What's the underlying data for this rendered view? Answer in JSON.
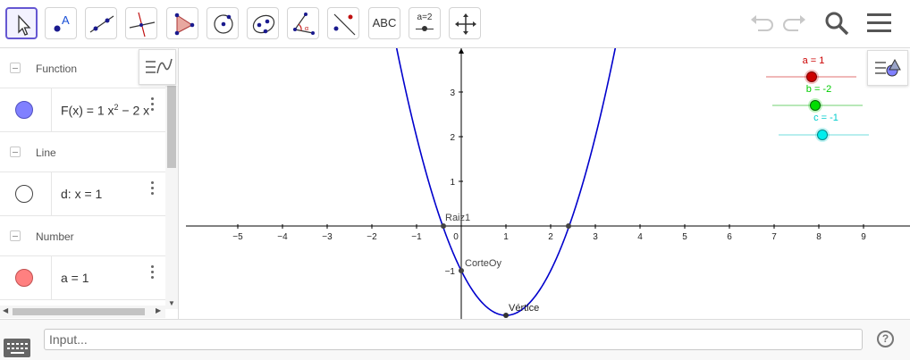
{
  "toolbar": {
    "text_tool_label": "ABC",
    "slider_tool_label": "a=2",
    "tools": [
      {
        "name": "move"
      },
      {
        "name": "point"
      },
      {
        "name": "line"
      },
      {
        "name": "perpendicular-line"
      },
      {
        "name": "polygon"
      },
      {
        "name": "circle-center-point"
      },
      {
        "name": "ellipse"
      },
      {
        "name": "angle"
      },
      {
        "name": "reflect-about-line"
      },
      {
        "name": "text"
      },
      {
        "name": "slider"
      },
      {
        "name": "move-graphics-view"
      }
    ]
  },
  "algebra": {
    "groups": [
      {
        "header": "Function",
        "item": {
          "prefix": "F(x) = 1 x",
          "sup": "2",
          "suffix": " − 2 x",
          "color": "#8080ff"
        }
      },
      {
        "header": "Line",
        "item": {
          "text": "d: x = 1",
          "color": "#ffffff"
        }
      },
      {
        "header": "Number",
        "item": {
          "text": "a = 1",
          "color": "#ff8080"
        }
      }
    ]
  },
  "graphics": {
    "x_ticks": [
      "−5",
      "−4",
      "−3",
      "−2",
      "−1",
      "0",
      "1",
      "2",
      "3",
      "4",
      "5",
      "6",
      "7",
      "8",
      "9"
    ],
    "y_ticks": [
      "3",
      "2",
      "1",
      "−1"
    ],
    "points": {
      "root1": "Raiz1",
      "y_intercept": "CorteOy",
      "vertex": "Vértice"
    },
    "sliders": [
      {
        "label": "a = 1",
        "value": 1,
        "color": "#cc0000"
      },
      {
        "label": "b = -2",
        "value": -2,
        "color": "#00cc00"
      },
      {
        "label": "c = -1",
        "value": -1,
        "color": "#00cccc"
      }
    ]
  },
  "input": {
    "placeholder": "Input..."
  },
  "help": {
    "label": "?"
  }
}
